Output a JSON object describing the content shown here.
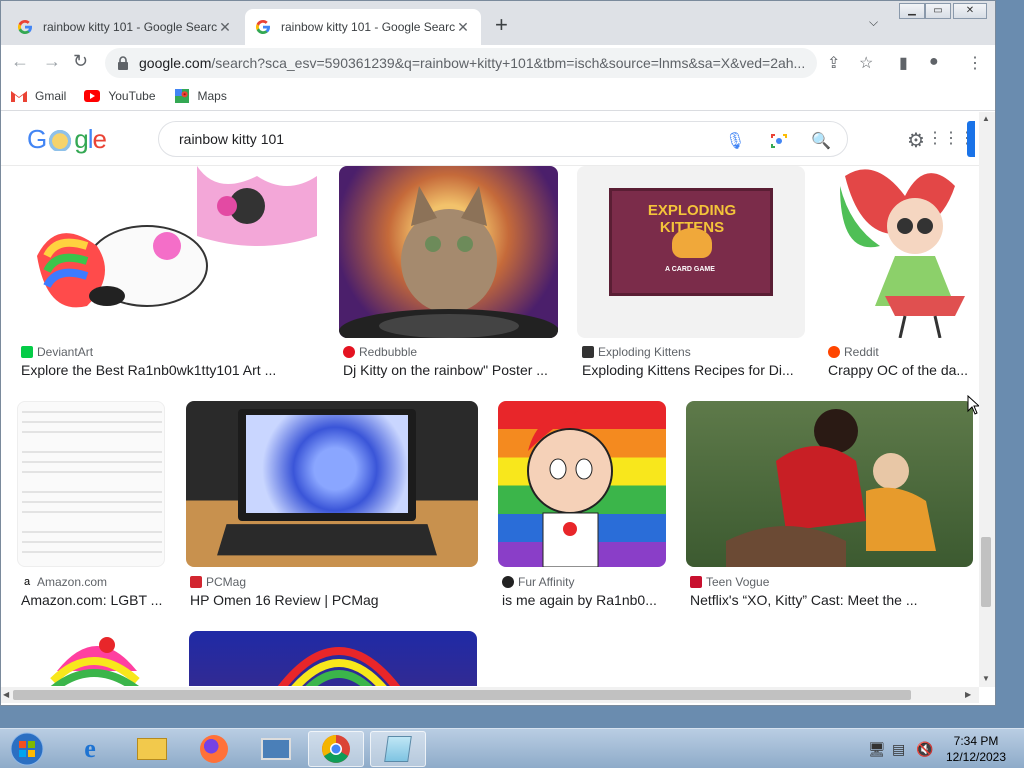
{
  "tabs": [
    {
      "title": "rainbow kitty 101 - Google Searc",
      "active": false
    },
    {
      "title": "rainbow kitty 101 - Google Searc",
      "active": true
    }
  ],
  "omnibox": {
    "url_host": "google.com",
    "url_path": "/search?sca_esv=590361239&q=rainbow+kitty+101&tbm=isch&source=lnms&sa=X&ved=2ah..."
  },
  "bookmarks": [
    {
      "label": "Gmail",
      "icon": "gmail-icon"
    },
    {
      "label": "YouTube",
      "icon": "youtube-icon"
    },
    {
      "label": "Maps",
      "icon": "maps-icon"
    }
  ],
  "google": {
    "query": "rainbow kitty 101"
  },
  "results": [
    {
      "source": "DeviantArt",
      "title": "Explore the Best Ra1nb0wk1tty101 Art ...",
      "source_color": "#05cc47"
    },
    {
      "source": "Redbubble",
      "title": "Dj Kitty on the rainbow\" Poster ...",
      "source_color": "#e41321"
    },
    {
      "source": "Exploding Kittens",
      "title": "Exploding Kittens Recipes for Di...",
      "source_color": "#333333"
    },
    {
      "source": "Reddit",
      "title": "Crappy OC of the da...",
      "source_color": "#ff4500"
    },
    {
      "source": "Amazon.com",
      "title": "Amazon.com: LGBT ...",
      "source_color": "#232f3e"
    },
    {
      "source": "PCMag",
      "title": "HP Omen 16 Review | PCMag",
      "source_color": "#d22630"
    },
    {
      "source": "Fur Affinity",
      "title": "is me again by Ra1nb0...",
      "source_color": "#222222"
    },
    {
      "source": "Teen Vogue",
      "title": "Netflix's “XO, Kitty” Cast: Meet the ...",
      "source_color": "#c8102e"
    }
  ],
  "product_text": {
    "title": "EXPLODING KITTENS",
    "subtitle": "A CARD GAME"
  },
  "taskbar": {
    "time": "7:34 PM",
    "date": "12/12/2023"
  }
}
